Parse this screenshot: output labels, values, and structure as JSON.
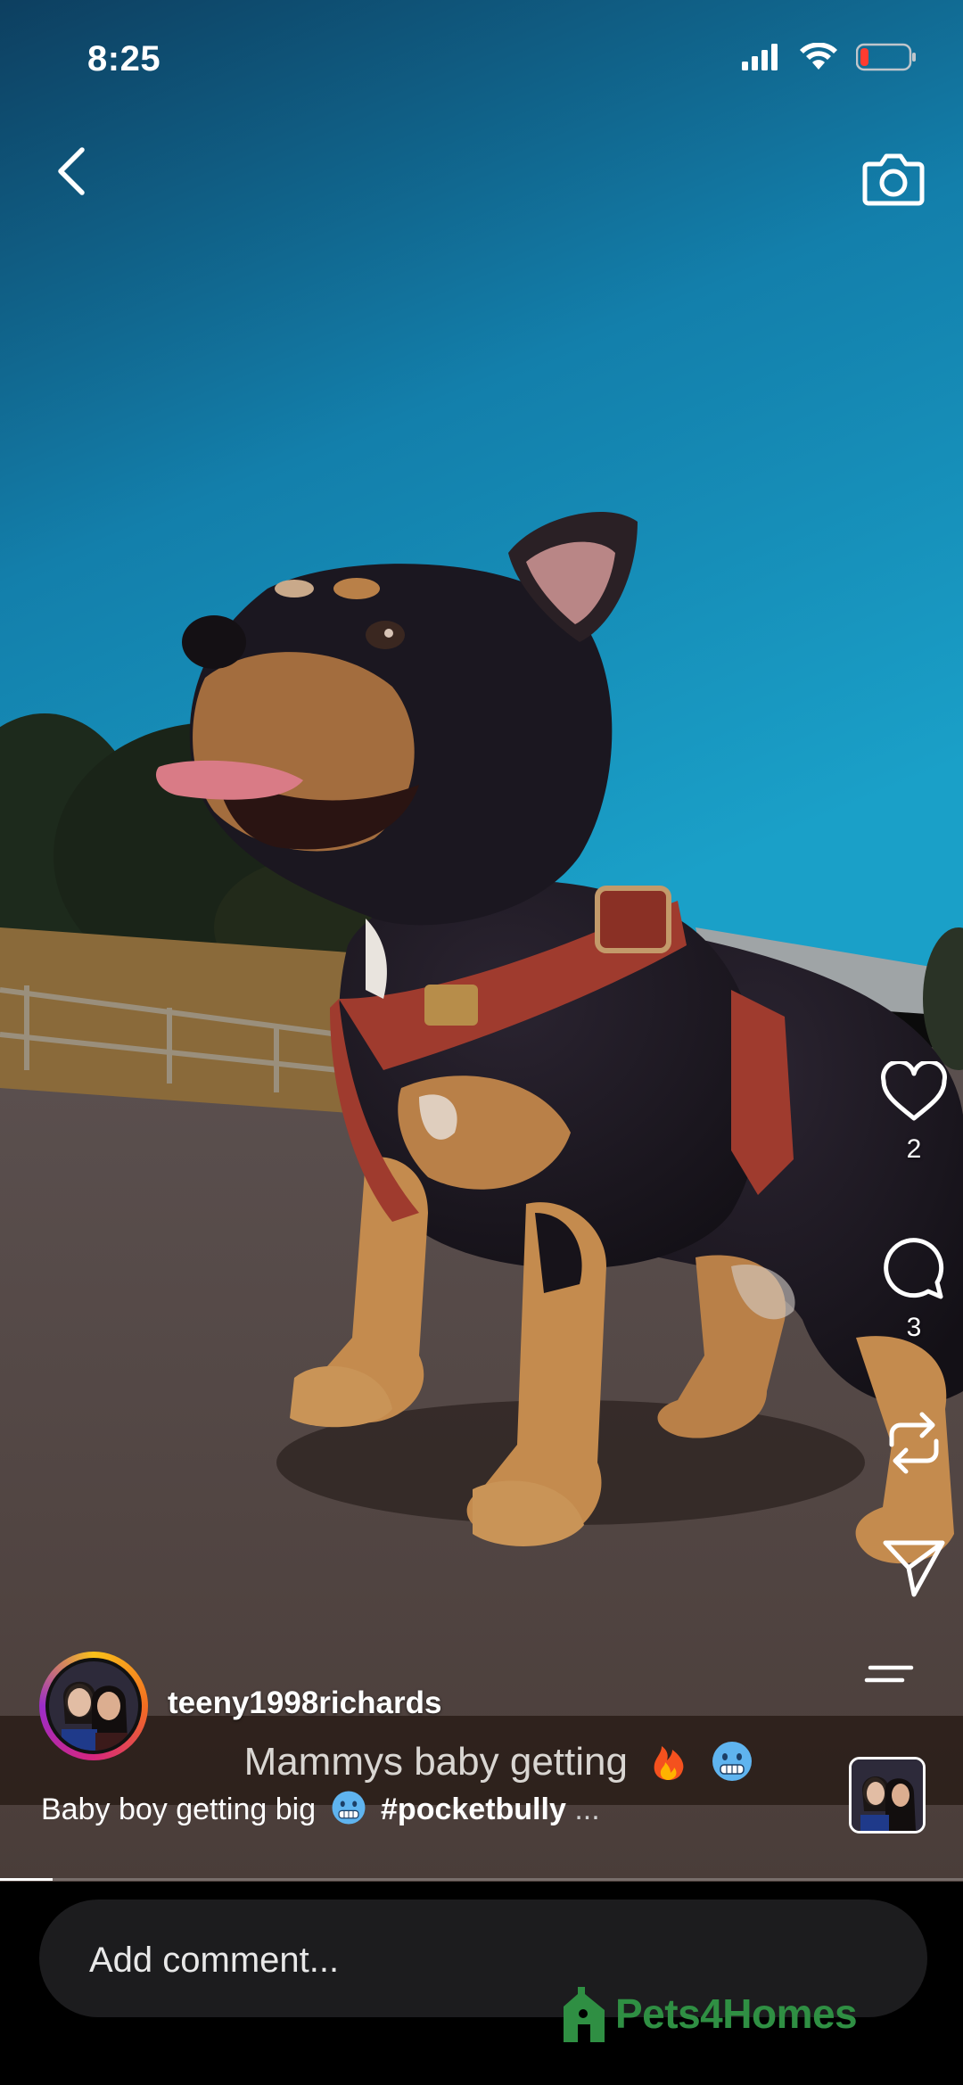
{
  "status_bar": {
    "time": "8:25"
  },
  "post": {
    "username": "teeny1998richards",
    "music_text": "Mammys baby getting",
    "caption_text": "Baby boy getting big",
    "caption_hashtag": "#pocketbully",
    "caption_more": "...",
    "progress": 0.055
  },
  "actions": {
    "likes": "2",
    "comments": "3"
  },
  "comment_input": {
    "placeholder": "Add comment..."
  },
  "watermark": {
    "text": "Pets4Homes"
  },
  "colors": {
    "sky_top": "#0f4a6e",
    "sky_bottom": "#1391bd",
    "road": "#5a4c48",
    "watermark_green": "#2f8f43"
  },
  "icons": [
    "back-arrow",
    "camera",
    "heart",
    "comment-bubble",
    "repost",
    "send",
    "menu-lines"
  ]
}
